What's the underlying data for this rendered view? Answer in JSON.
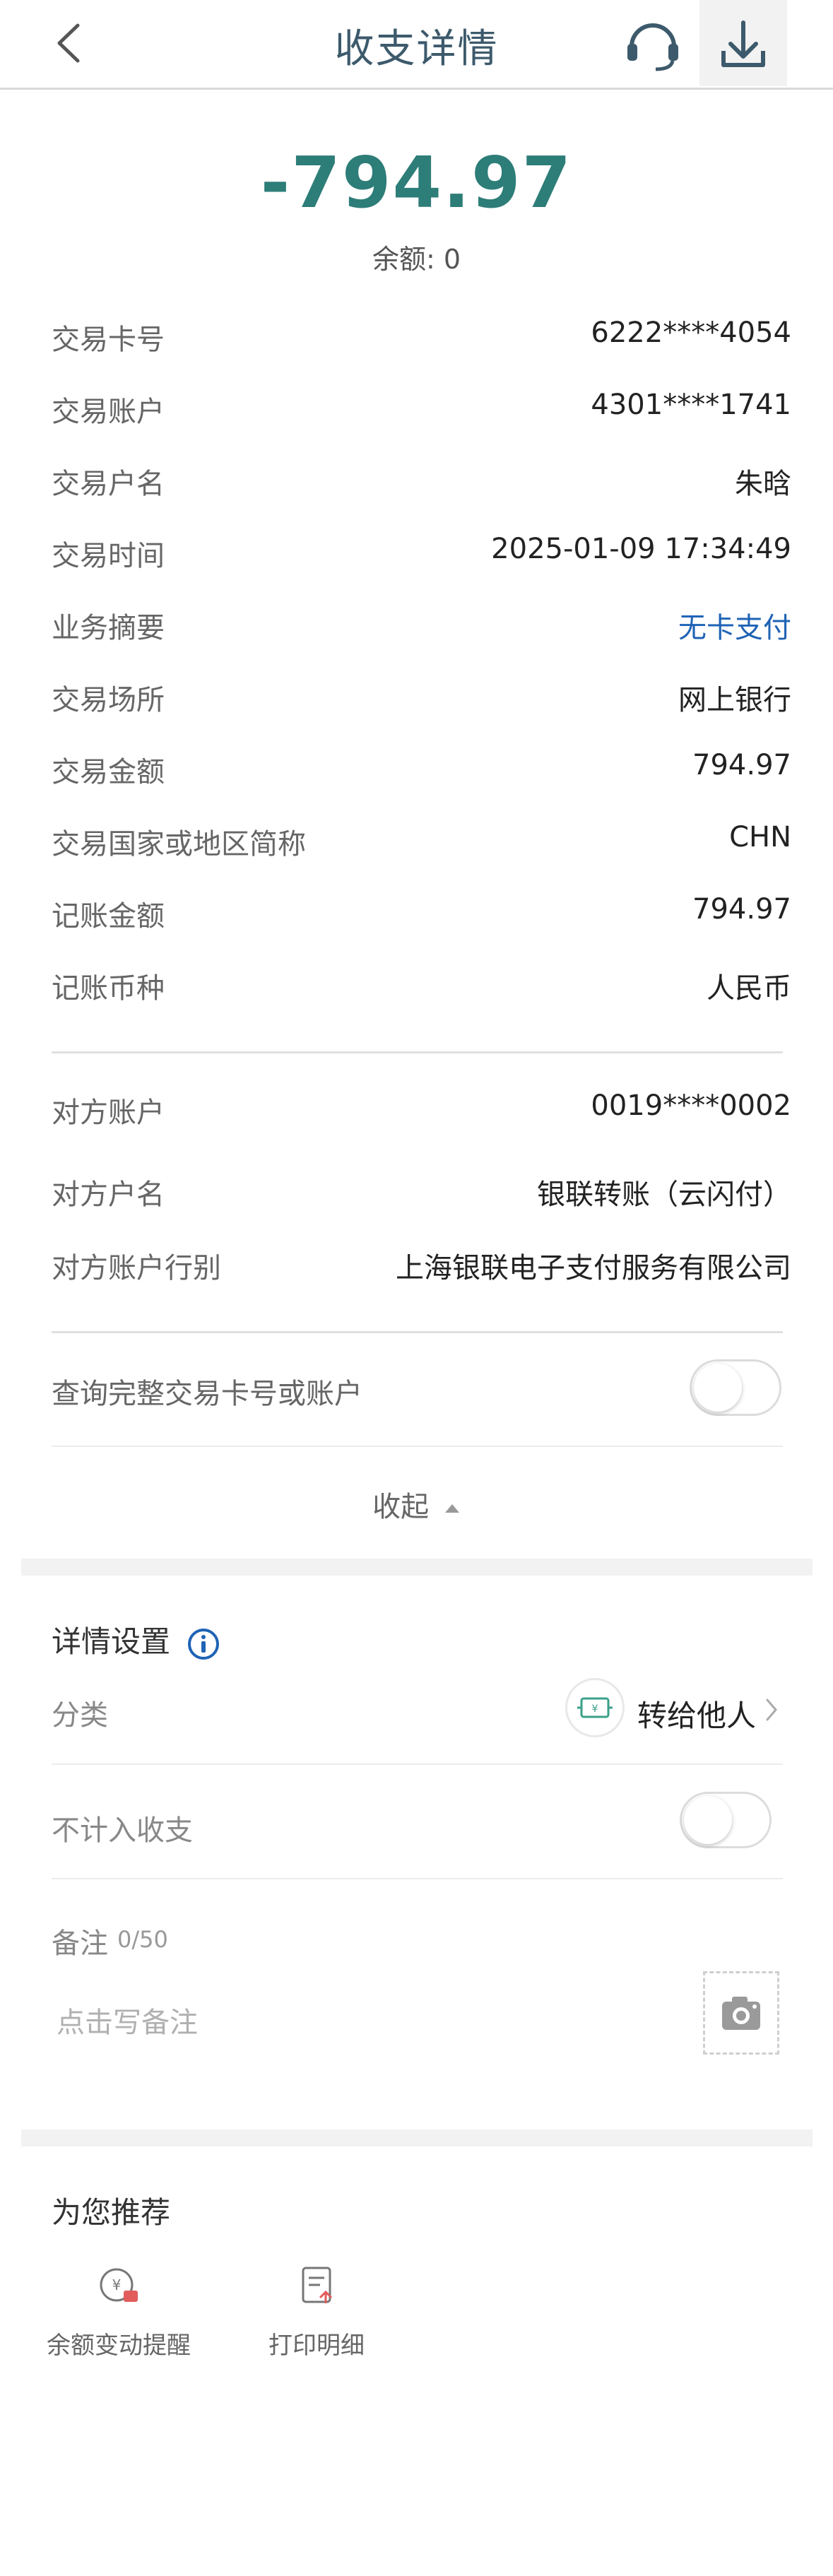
{
  "header": {
    "title": "收支详情",
    "back_icon": "chevron-left-icon",
    "service_icon": "headset-icon",
    "download_icon": "download-icon"
  },
  "summary": {
    "amount": "-794.97",
    "balance": "余额: 0"
  },
  "details": [
    {
      "label": "交易卡号",
      "value": "6222****4054"
    },
    {
      "label": "交易账户",
      "value": "4301****1741"
    },
    {
      "label": "交易户名",
      "value": "朱晗"
    },
    {
      "label": "交易时间",
      "value": "2025-01-09 17:34:49"
    },
    {
      "label": "业务摘要",
      "value": "无卡支付"
    },
    {
      "label": "交易场所",
      "value": "网上银行"
    },
    {
      "label": "交易金额",
      "value": "794.97"
    },
    {
      "label": "交易国家或地区简称",
      "value": "CHN"
    },
    {
      "label": "记账金额",
      "value": "794.97"
    },
    {
      "label": "记账币种",
      "value": "人民币"
    }
  ],
  "counterparty": [
    {
      "label": "对方账户",
      "value": "0019****0002"
    },
    {
      "label": "对方户名",
      "value": "银联转账（云闪付）"
    },
    {
      "label": "对方账户行别",
      "value": "上海银联电子支付服务有限公司"
    }
  ],
  "full_card_toggle": {
    "label": "查询完整交易卡号或账户",
    "on": false
  },
  "collapse_label": "收起",
  "settings": {
    "title": "详情设置",
    "category_label": "分类",
    "category_value": "转给他人",
    "exclude_label": "不计入收支",
    "exclude_on": false,
    "memo_label": "备注",
    "memo_count": "0/50",
    "memo_placeholder": "点击写备注"
  },
  "recommend": {
    "title": "为您推荐",
    "items": [
      {
        "label": "余额变动提醒",
        "icon": "balance-alert-icon"
      },
      {
        "label": "打印明细",
        "icon": "print-detail-icon"
      }
    ]
  },
  "colors": {
    "amount": "#2d7d78",
    "link": "#1f63b5",
    "info": "#1f63b5"
  }
}
